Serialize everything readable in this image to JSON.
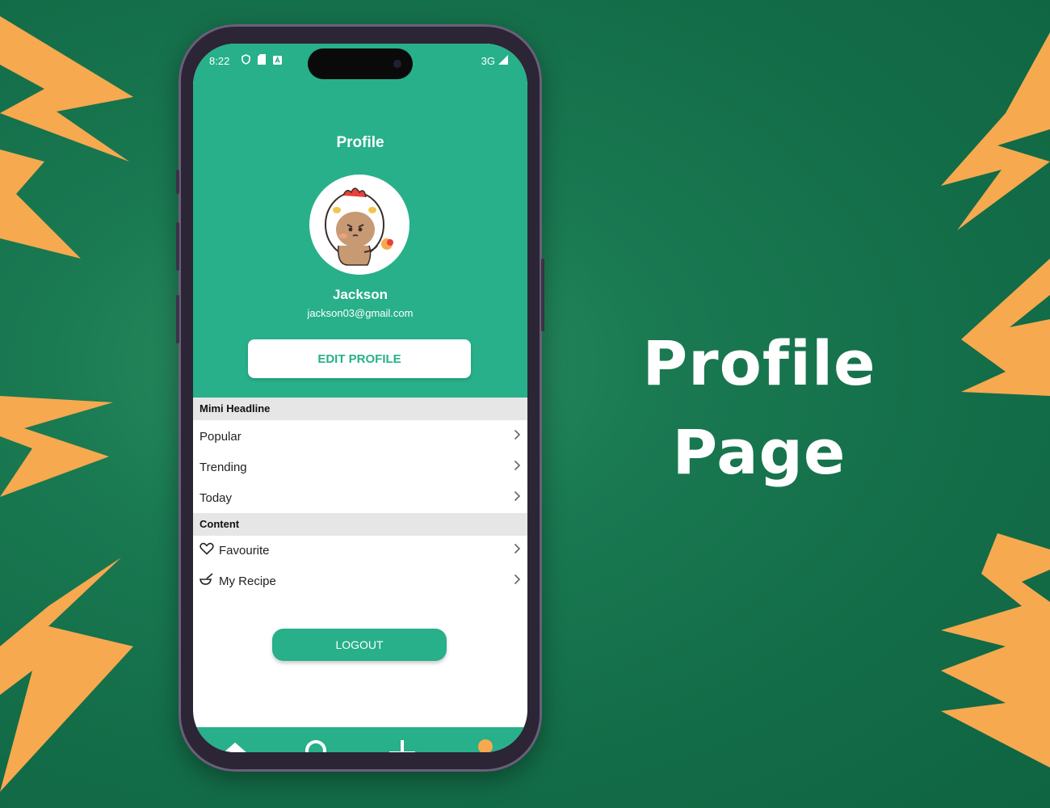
{
  "poster": {
    "title_line1": "Profile",
    "title_line2": "Page"
  },
  "colors": {
    "background": "#146c47",
    "accent": "#27b08a",
    "bolt": "#f6a94f",
    "active_tab": "#f6a94f"
  },
  "status_bar": {
    "time": "8:22",
    "network": "3G",
    "icons": [
      "shield-icon",
      "sim-icon",
      "a-icon",
      "signal-icon"
    ]
  },
  "profile": {
    "title": "Profile",
    "name": "Jackson",
    "email": "jackson03@gmail.com",
    "edit_label": "EDIT PROFILE"
  },
  "sections": [
    {
      "header": "Mimi Headline",
      "items": [
        "Popular",
        "Trending",
        "Today"
      ]
    },
    {
      "header": "Content",
      "items": [
        {
          "label": "Favourite",
          "icon": "heart-icon"
        },
        {
          "label": "My Recipe",
          "icon": "bowl-icon"
        }
      ]
    }
  ],
  "logout_label": "LOGOUT",
  "tabs": [
    {
      "icon": "home-icon",
      "active": false
    },
    {
      "icon": "search-icon",
      "active": false
    },
    {
      "icon": "plus-icon",
      "active": false
    },
    {
      "icon": "user-icon",
      "active": true
    }
  ]
}
